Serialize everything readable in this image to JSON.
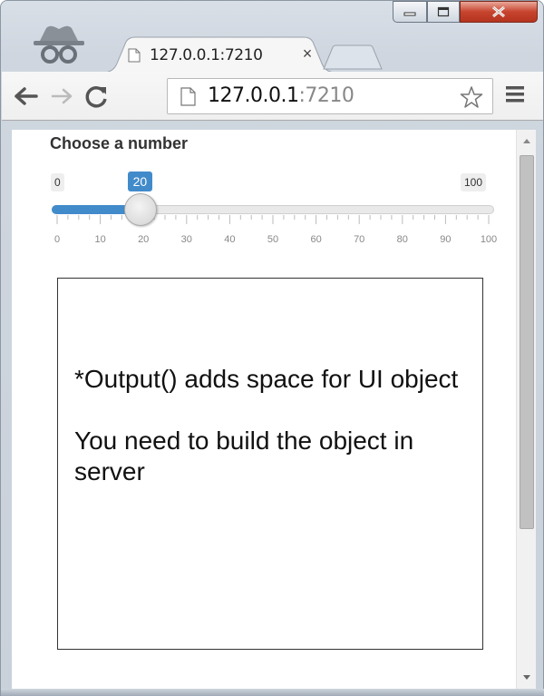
{
  "window": {
    "tab_title": "127.0.0.1:7210",
    "tab_close": "×"
  },
  "toolbar": {
    "url_host": "127.0.0.1",
    "url_port": ":7210"
  },
  "slider": {
    "label": "Choose a number",
    "min": 0,
    "max": 100,
    "value": 20,
    "min_label": "0",
    "max_label": "100",
    "value_label": "20",
    "ticks": [
      "0",
      "10",
      "20",
      "30",
      "40",
      "50",
      "60",
      "70",
      "80",
      "90",
      "100"
    ],
    "accent": "#428bca"
  },
  "output": {
    "line1": "*Output() adds space for UI object",
    "line2": "You need to build the object in server"
  },
  "scrollbar": {
    "position": 0
  }
}
